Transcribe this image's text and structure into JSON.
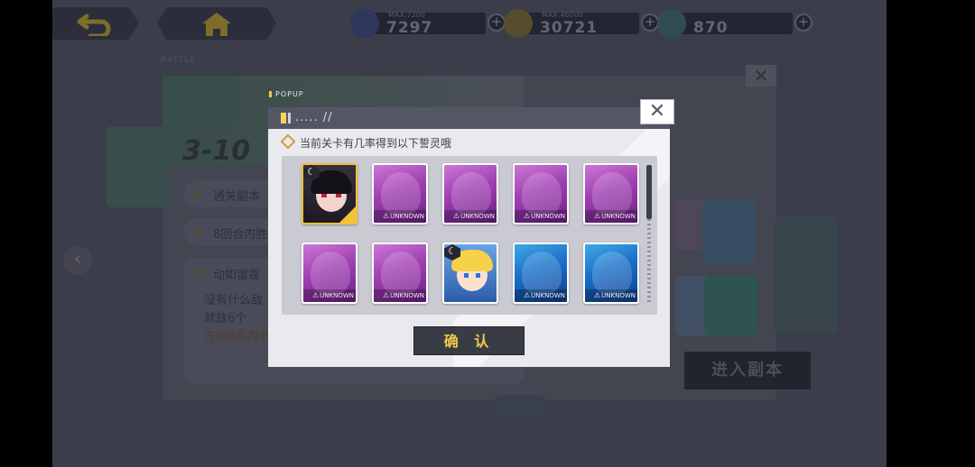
{
  "topbar": {
    "back_icon": "return-arrow-icon",
    "home_icon": "home-icon",
    "resources": [
      {
        "icon": "card-resource-icon",
        "max": "MAX:7200",
        "value": "7297",
        "color": "#3b6fd0"
      },
      {
        "icon": "gold-coin-icon",
        "max": "MAX:46000",
        "value": "30721",
        "color": "#c9a22b"
      },
      {
        "icon": "crystal-icon",
        "max": "",
        "value": "870",
        "color": "#3fb9a5"
      }
    ]
  },
  "background": {
    "section_tag": "BATTLE",
    "stage_number": "3-10",
    "objectives": [
      "通关副本",
      "8回合内胜",
      "动如雷霆"
    ],
    "description_lines": [
      "没有什么敌",
      "就放6个"
    ],
    "description_highlight": "在6回合内消",
    "enter_button": "进入副本"
  },
  "popup": {
    "tag": "POPUP",
    "header_text": "..... //",
    "prompt": "当前关卡有几率得到以下誓灵哦",
    "unknown_label": "UNKNOWN",
    "cards": [
      {
        "kind": "char1",
        "known": true
      },
      {
        "kind": "purple",
        "known": false
      },
      {
        "kind": "purple",
        "known": false
      },
      {
        "kind": "purple",
        "known": false
      },
      {
        "kind": "purple",
        "known": false
      },
      {
        "kind": "purple",
        "known": false
      },
      {
        "kind": "purple",
        "known": false
      },
      {
        "kind": "char2",
        "known": true
      },
      {
        "kind": "blue",
        "known": false
      },
      {
        "kind": "blue",
        "known": false
      }
    ],
    "confirm_label": "确 认",
    "accent_color": "#f2c94c"
  }
}
